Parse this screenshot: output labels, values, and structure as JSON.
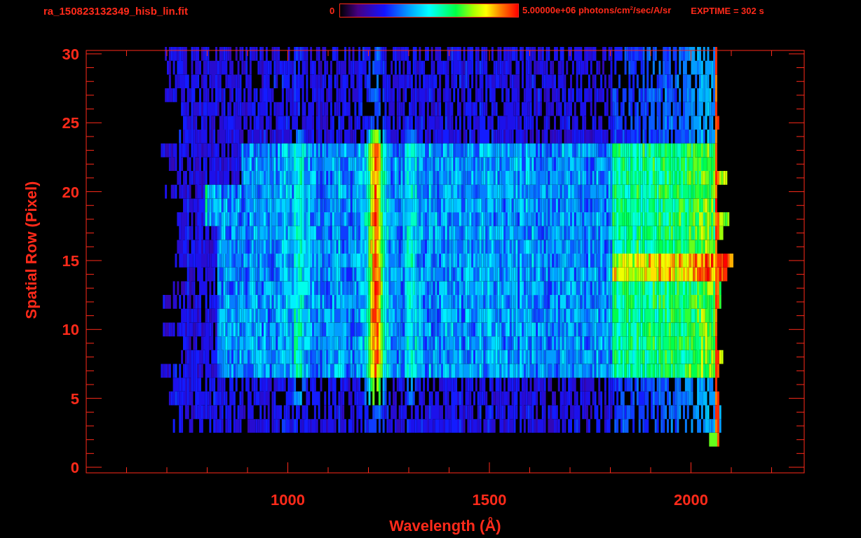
{
  "header": {
    "title": "ra_150823132349_hisb_lin.fit",
    "colorbar_min": "0",
    "colorbar_max": "5.00000e+06 photons/cm$^{2}$/sec/A/sr",
    "exposure": "EXPTIME = 302 s"
  },
  "plot": {
    "xlabel": "Wavelength (Å)",
    "ylabel": "Spatial Row (Pixel)",
    "xticks": [
      "1000",
      "1500",
      "2000"
    ],
    "yticks": [
      "30",
      "25",
      "20",
      "15",
      "10",
      "5",
      "0"
    ]
  }
}
